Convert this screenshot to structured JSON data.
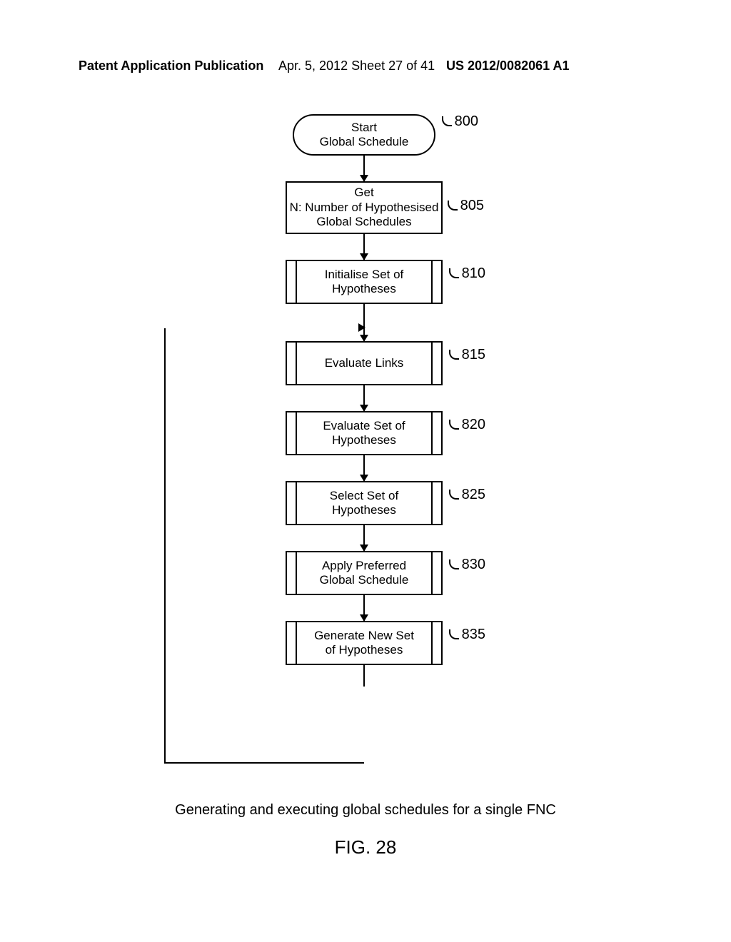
{
  "header": {
    "left": "Patent Application Publication",
    "mid": "Apr. 5, 2012   Sheet 27 of 41",
    "right": "US 2012/0082061 A1"
  },
  "steps": {
    "s800": {
      "ref": "800",
      "l1": "Start",
      "l2": "Global Schedule"
    },
    "s805": {
      "ref": "805",
      "l1": "Get",
      "l2": "N: Number of Hypothesised",
      "l3": "Global Schedules"
    },
    "s810": {
      "ref": "810",
      "l1": "Initialise Set of",
      "l2": "Hypotheses"
    },
    "s815": {
      "ref": "815",
      "l1": "Evaluate Links"
    },
    "s820": {
      "ref": "820",
      "l1": "Evaluate Set of",
      "l2": "Hypotheses"
    },
    "s825": {
      "ref": "825",
      "l1": "Select Set of",
      "l2": "Hypotheses"
    },
    "s830": {
      "ref": "830",
      "l1": "Apply Preferred",
      "l2": "Global Schedule"
    },
    "s835": {
      "ref": "835",
      "l1": "Generate New Set",
      "l2": "of Hypotheses"
    }
  },
  "caption": "Generating and executing global schedules for a single FNC",
  "figure_label": "FIG. 28"
}
